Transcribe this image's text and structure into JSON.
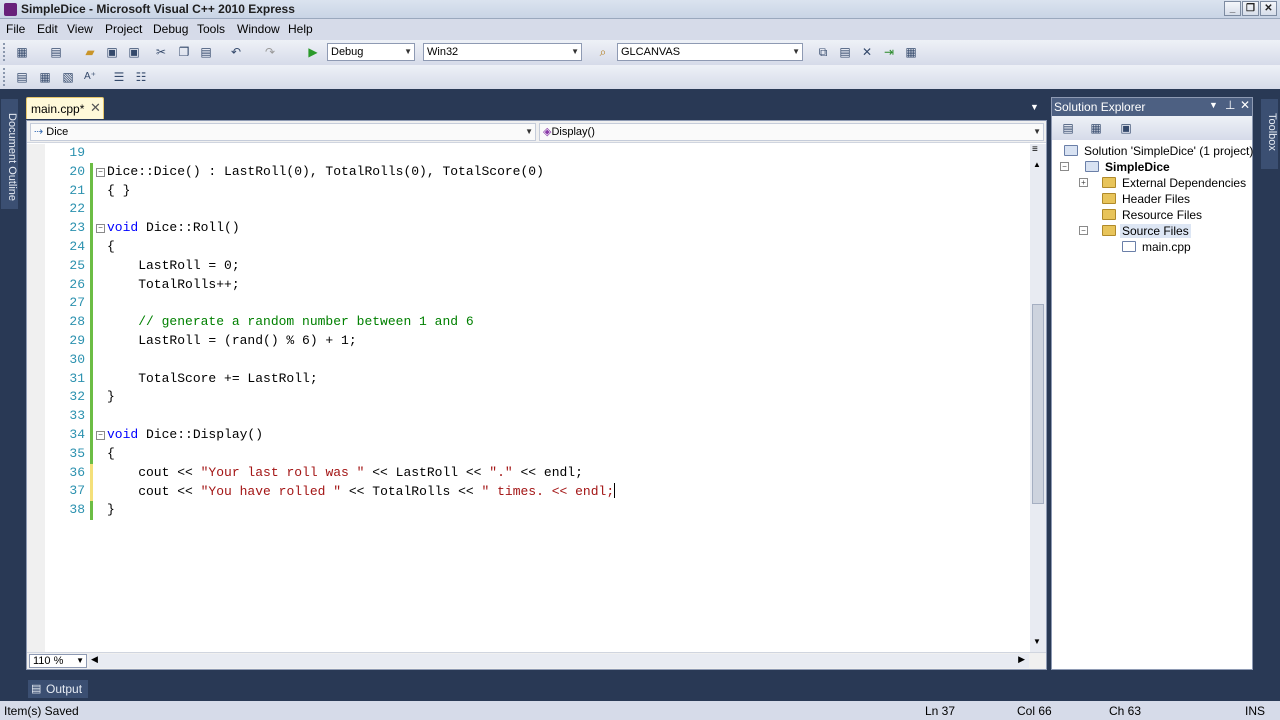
{
  "window": {
    "title": "SimpleDice - Microsoft Visual C++ 2010 Express",
    "controls": [
      "_",
      "❐",
      "✕"
    ]
  },
  "menu": [
    "File",
    "Edit",
    "View",
    "Project",
    "Debug",
    "Tools",
    "Window",
    "Help"
  ],
  "toolbar": {
    "config": "Debug",
    "platform": "Win32",
    "find": "GLCANVAS"
  },
  "editor": {
    "tab_label": "main.cpp*",
    "tab_close": "✕",
    "nav_left": "Dice",
    "nav_right": "Display()",
    "zoom": "110 %",
    "lines": [
      {
        "n": "19",
        "fold": "",
        "parts": [],
        "chg": ""
      },
      {
        "n": "20",
        "fold": "⊟",
        "parts": [
          {
            "t": "Dice::Dice() : LastRoll(0), TotalRolls(0), TotalScore(0)",
            "c": ""
          }
        ],
        "chg": "#6cbd45"
      },
      {
        "n": "21",
        "fold": "",
        "parts": [
          {
            "t": "{ }",
            "c": ""
          }
        ],
        "chg": "#6cbd45"
      },
      {
        "n": "22",
        "fold": "",
        "parts": [],
        "chg": "#6cbd45"
      },
      {
        "n": "23",
        "fold": "⊟",
        "parts": [
          {
            "t": "void",
            "c": "kw"
          },
          {
            "t": " Dice::Roll()",
            "c": ""
          }
        ],
        "chg": "#6cbd45"
      },
      {
        "n": "24",
        "fold": "",
        "parts": [
          {
            "t": "{",
            "c": ""
          }
        ],
        "chg": "#6cbd45"
      },
      {
        "n": "25",
        "fold": "",
        "parts": [
          {
            "t": "    LastRoll = 0;",
            "c": ""
          }
        ],
        "chg": "#6cbd45"
      },
      {
        "n": "26",
        "fold": "",
        "parts": [
          {
            "t": "    TotalRolls++;",
            "c": ""
          }
        ],
        "chg": "#6cbd45"
      },
      {
        "n": "27",
        "fold": "",
        "parts": [],
        "chg": "#6cbd45"
      },
      {
        "n": "28",
        "fold": "",
        "parts": [
          {
            "t": "    // generate a random number between 1 and 6",
            "c": "cm"
          }
        ],
        "chg": "#6cbd45"
      },
      {
        "n": "29",
        "fold": "",
        "parts": [
          {
            "t": "    LastRoll = (rand() % 6) + 1;",
            "c": ""
          }
        ],
        "chg": "#6cbd45"
      },
      {
        "n": "30",
        "fold": "",
        "parts": [],
        "chg": "#6cbd45"
      },
      {
        "n": "31",
        "fold": "",
        "parts": [
          {
            "t": "    TotalScore += LastRoll;",
            "c": ""
          }
        ],
        "chg": "#6cbd45"
      },
      {
        "n": "32",
        "fold": "",
        "parts": [
          {
            "t": "}",
            "c": ""
          }
        ],
        "chg": "#6cbd45"
      },
      {
        "n": "33",
        "fold": "",
        "parts": [],
        "chg": "#6cbd45"
      },
      {
        "n": "34",
        "fold": "⊟",
        "parts": [
          {
            "t": "void",
            "c": "kw"
          },
          {
            "t": " Dice::Display()",
            "c": ""
          }
        ],
        "chg": "#6cbd45"
      },
      {
        "n": "35",
        "fold": "",
        "parts": [
          {
            "t": "{",
            "c": ""
          }
        ],
        "chg": "#6cbd45"
      },
      {
        "n": "36",
        "fold": "",
        "parts": [
          {
            "t": "    cout << ",
            "c": ""
          },
          {
            "t": "\"Your last roll was \"",
            "c": "str"
          },
          {
            "t": " << LastRoll << ",
            "c": ""
          },
          {
            "t": "\".\"",
            "c": "str"
          },
          {
            "t": " << endl;",
            "c": ""
          }
        ],
        "chg": "#f4e07a"
      },
      {
        "n": "37",
        "fold": "",
        "parts": [
          {
            "t": "    cout << ",
            "c": ""
          },
          {
            "t": "\"You have rolled \"",
            "c": "str"
          },
          {
            "t": " << TotalRolls << ",
            "c": ""
          },
          {
            "t": "\" times. << endl;",
            "c": "str"
          }
        ],
        "chg": "#f4e07a"
      },
      {
        "n": "38",
        "fold": "",
        "parts": [
          {
            "t": "}",
            "c": ""
          }
        ],
        "chg": "#6cbd45"
      }
    ]
  },
  "solution_explorer": {
    "title": "Solution Explorer",
    "items": [
      {
        "label": "Solution 'SimpleDice' (1 project)",
        "level": 0,
        "exp": "",
        "bold": false,
        "sel": false
      },
      {
        "label": "SimpleDice",
        "level": 1,
        "exp": "⊟",
        "bold": true,
        "sel": false
      },
      {
        "label": "External Dependencies",
        "level": 2,
        "exp": "⊞",
        "bold": false,
        "sel": false
      },
      {
        "label": "Header Files",
        "level": 2,
        "exp": "",
        "bold": false,
        "sel": false
      },
      {
        "label": "Resource Files",
        "level": 2,
        "exp": "",
        "bold": false,
        "sel": false
      },
      {
        "label": "Source Files",
        "level": 2,
        "exp": "⊟",
        "bold": false,
        "sel": true
      },
      {
        "label": "main.cpp",
        "level": 3,
        "exp": "",
        "bold": false,
        "sel": false
      }
    ]
  },
  "side_tabs": {
    "left": "Document Outline",
    "right": "Toolbox"
  },
  "output_tab": "Output",
  "status": {
    "message": "Item(s) Saved",
    "ln": "Ln 37",
    "col": "Col 66",
    "ch": "Ch 63",
    "mode": "INS"
  }
}
